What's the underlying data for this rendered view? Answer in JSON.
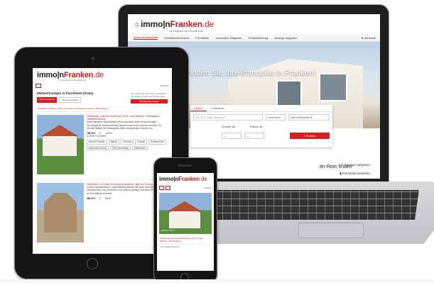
{
  "laptop": {
    "brand_main": "immo|nFranken",
    "brand_part1": "immo|n",
    "brand_part2": "Franken",
    "brand_tld": ".de",
    "subtitle": "Ein Angebot von inFranken.de",
    "nav": [
      "Immo.inFranken.de",
      "Anbieterverzeichnis",
      "Für Makler",
      "Immobilien Ratgeber",
      "Preisbewertung",
      "Anzeige aufgeben"
    ],
    "merkliste": "Merkliste",
    "hero_text": "inden Sie Ihre Immobilie in Franken!",
    "search": {
      "tab_buy": "Kaufen",
      "tab_rent": "Verwerte",
      "input_placeholder": "Ort, PLZ oder Objekt-ID",
      "umkreis": "Umkreis",
      "type": "Alle Wohnarten",
      "zimmer_label": "Zimmer ab",
      "flaeche_label": "Fläche ab",
      "dash1": "---",
      "dash2": "---",
      "submit": "Suchen"
    },
    "section_title": "en Rom finden",
    "anzeige": "Anzeige aufgeben",
    "anzeige2": "Immobilie bewerten"
  },
  "tablet": {
    "brand_part1": "immo|n",
    "brand_part2": "Franken",
    "brand_tld": ".de",
    "subtitle": "Ein Angebot von inFranken.de",
    "merkliste": "Merkliste",
    "title": "Mietwohnungen in Forchheim (Kreis)",
    "side_text": "Sie suchen Sie Ihre Neue Immobilie in Ihre Region? Jetzt dein Suchauftrag",
    "side_btn": "Suchauftrag anlegen",
    "btn_search": "Suche anpassen",
    "btn_sort": "Neueste Anzeige",
    "breadcrumb": "Immobilien Franken  ›  Wohnung mieten in Forchheim (Kreis)  ›  168 Angebote",
    "listings": [
      {
        "title": "Geräumige 3-Zimmer-Wohnung, 120m², zwei Balkone, Wintergarten, Gartenbenutzung",
        "desc": "Diese attraktive, modernisierte Wohnung bietet Ihnen ein großzügiges Raumangebot, lichtdurchflutete Zimmer sowie einen schönen Ausblick. Ein schöner Balkon mit Wintergarten lädt zu entspannten Stunden ein.",
        "price": "780,00 €",
        "rooms": "3",
        "area": "120 m²",
        "location": "91301 Forchheim",
        "tags": [
          "Bad mit Fenster",
          "Balkon",
          "Terrasse",
          "Dusche",
          "Einbauküche",
          "Gartenbenutzung",
          "Personenaufzug",
          "Kelleranteil"
        ]
      },
      {
        "title": "Gemütliche 2-Zimmer-Wohnung in zentraler Lage von Coburg",
        "desc": "In einer repräsentativen Jugendstilvilla befindet sich diese Wohnung im Obergeschoss. Die Wohnung ist im Zentrum gelegen und bietet Ihnen über 60 m² Wohnfläche und mehr ...",
        "price": "380,00 €",
        "rooms": "2",
        "area": "65 m²"
      }
    ]
  },
  "phone": {
    "brand_part1": "immo|n",
    "brand_part2": "Franken",
    "brand_tld": ".de",
    "merkliste": "Merkliste",
    "price_tag": "780,00 €  120 m²",
    "text": "Geräumige 3-Zimmer-Wohnung, 120m², zwei Balkone, Wintergarten.",
    "foot": "Neue aktuelle Angebote  ›"
  }
}
